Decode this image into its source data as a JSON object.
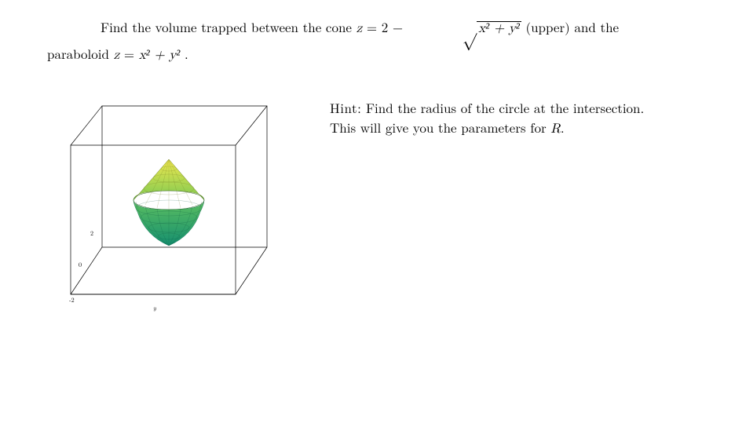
{
  "problem": {
    "intro": "Find the volume trapped between the cone ",
    "cone_eq_lhs": "z",
    "cone_eq_eq": " = ",
    "cone_eq_rhs_prefix": "2 − ",
    "sqrt_content": "x² + y²",
    "upper_label": " (upper) and the",
    "line2_prefix": "paraboloid ",
    "paraboloid_eq_lhs": "z",
    "paraboloid_eq_eq": " = ",
    "paraboloid_eq_rhs": "x² + y²",
    "line2_suffix": "."
  },
  "hint": {
    "label": "Hint:",
    "text1": "  Find the radius of the circle at the intersection.",
    "text2": "This will give you the parameters for ",
    "R": "R",
    "suffix": "."
  },
  "figure": {
    "axis_labels": [
      "-2",
      "0",
      "2"
    ],
    "y_label": "y"
  },
  "chart_data": {
    "type": "3d-surface",
    "title": "Region between cone and paraboloid",
    "surfaces": [
      {
        "name": "cone",
        "equation": "z = 2 - sqrt(x^2 + y^2)",
        "role": "upper"
      },
      {
        "name": "paraboloid",
        "equation": "z = x^2 + y^2",
        "role": "lower"
      }
    ],
    "intersection": {
      "radius": 1,
      "z": 1
    },
    "bounds": {
      "x": [
        -2,
        2
      ],
      "y": [
        -2,
        2
      ],
      "z": [
        0,
        2
      ]
    },
    "colormap": "green-yellow",
    "box": true,
    "axis_ticks": [
      -2,
      0,
      2
    ]
  }
}
